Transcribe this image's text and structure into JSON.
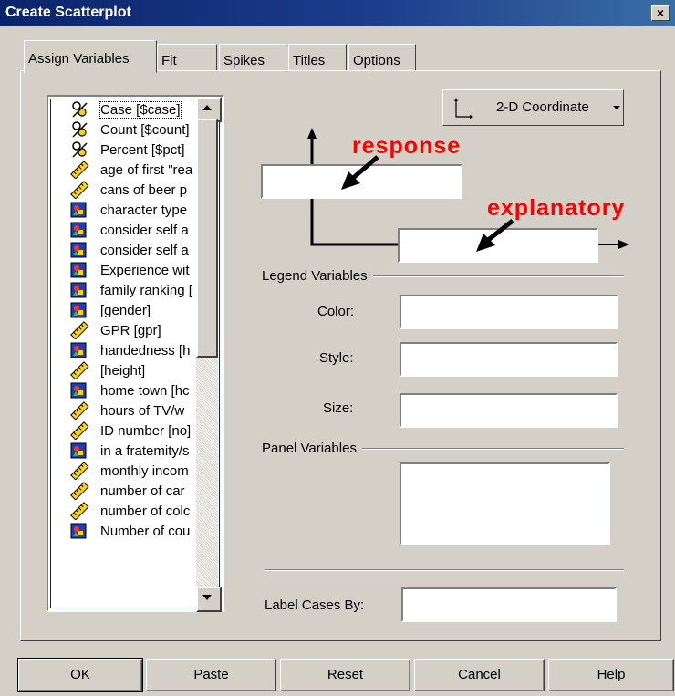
{
  "window": {
    "title": "Create Scatterplot",
    "close_glyph": "×"
  },
  "tabs": [
    {
      "label": "Assign Variables",
      "active": true
    },
    {
      "label": "Fit"
    },
    {
      "label": "Spikes"
    },
    {
      "label": "Titles"
    },
    {
      "label": "Options"
    }
  ],
  "variables": [
    {
      "label": "Case [$case]",
      "icon": "system-variable-icon"
    },
    {
      "label": "Count [$count]",
      "icon": "system-variable-icon"
    },
    {
      "label": "Percent [$pct]",
      "icon": "system-variable-icon"
    },
    {
      "label": "age of first \"rea",
      "icon": "scale-ruler-icon"
    },
    {
      "label": "cans of beer p",
      "icon": "scale-ruler-icon"
    },
    {
      "label": "character type",
      "icon": "nominal-variable-icon"
    },
    {
      "label": "consider self a",
      "icon": "nominal-variable-icon"
    },
    {
      "label": "consider self a",
      "icon": "nominal-variable-icon"
    },
    {
      "label": "Experience wit",
      "icon": "nominal-variable-icon"
    },
    {
      "label": "family ranking [",
      "icon": "nominal-variable-icon"
    },
    {
      "label": "[gender]",
      "icon": "nominal-variable-icon"
    },
    {
      "label": "GPR [gpr]",
      "icon": "scale-ruler-icon"
    },
    {
      "label": "handedness [h",
      "icon": "nominal-variable-icon"
    },
    {
      "label": "[height]",
      "icon": "scale-ruler-icon"
    },
    {
      "label": "home town [hc",
      "icon": "nominal-variable-icon"
    },
    {
      "label": "hours of TV/w",
      "icon": "scale-ruler-icon"
    },
    {
      "label": "ID number [no]",
      "icon": "scale-ruler-icon"
    },
    {
      "label": "in a fratemity/s",
      "icon": "nominal-variable-icon"
    },
    {
      "label": "monthly incom",
      "icon": "scale-ruler-icon"
    },
    {
      "label": "number of car",
      "icon": "scale-ruler-icon"
    },
    {
      "label": "number of colc",
      "icon": "scale-ruler-icon"
    },
    {
      "label": "Number of cou",
      "icon": "nominal-variable-icon"
    }
  ],
  "coordinate_dropdown": {
    "label": "2-D Coordinate",
    "icon": "axes-icon"
  },
  "annotations": {
    "response": "response",
    "explanatory": "explanatory"
  },
  "legend_variables": {
    "heading": "Legend Variables",
    "color_label": "Color:",
    "style_label": "Style:",
    "size_label": "Size:"
  },
  "panel_variables": {
    "heading": "Panel Variables"
  },
  "label_cases": {
    "label": "Label Cases By:"
  },
  "buttons": {
    "ok": "OK",
    "paste": "Paste",
    "reset": "Reset",
    "cancel": "Cancel",
    "help": "Help"
  },
  "colors": {
    "title_bar": "#0a246a",
    "face": "#d4d0c8",
    "annotation": "#ff0000"
  }
}
